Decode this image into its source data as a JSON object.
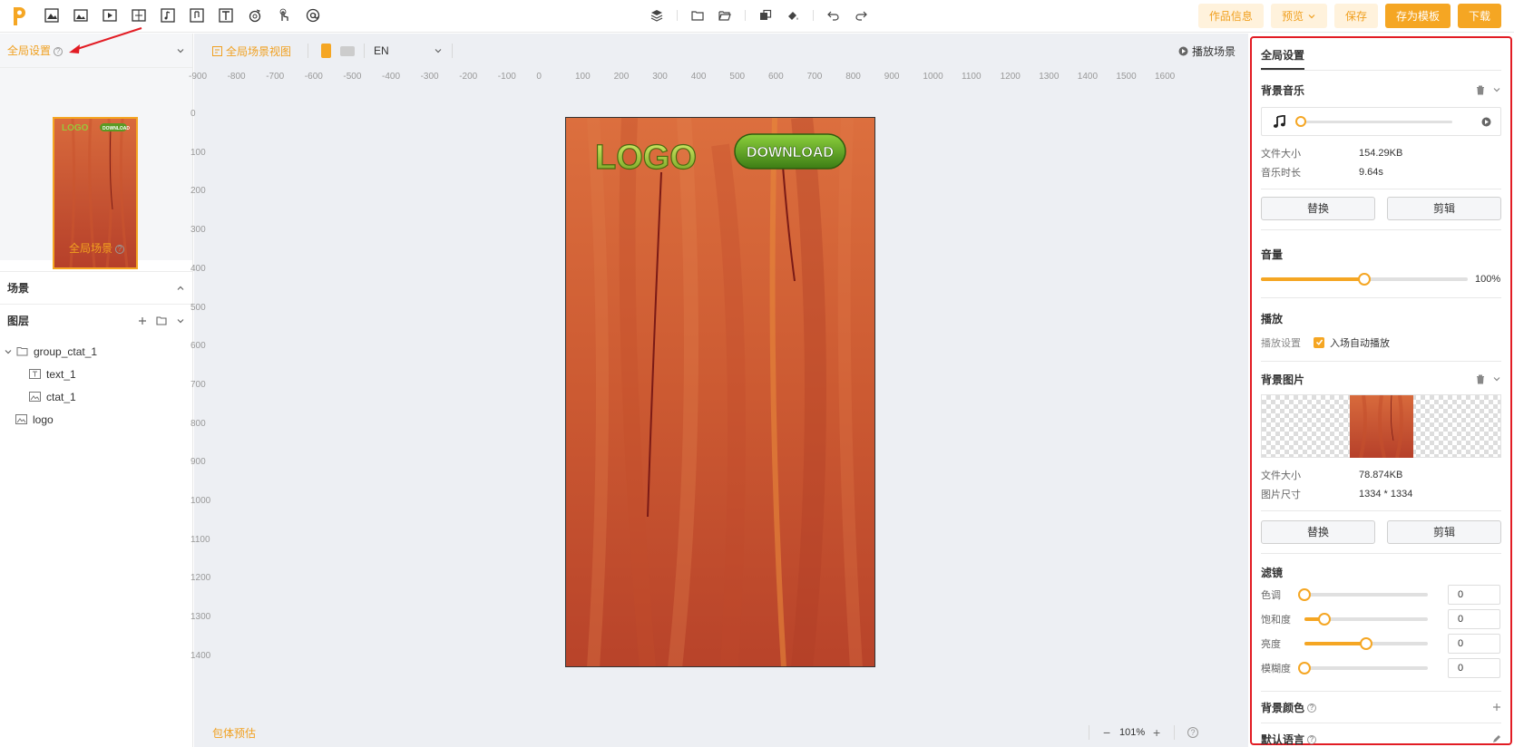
{
  "toolbar": {
    "buttons": {
      "info": "作品信息",
      "preview": "预览",
      "save": "保存",
      "save_template": "存为模板",
      "download": "下载"
    }
  },
  "left": {
    "global_settings": "全局设置",
    "global_scene": "全局场景",
    "scene_section": "场景",
    "layers_section": "图层",
    "layers": [
      "group_ctat_1",
      "text_1",
      "ctat_1",
      "logo"
    ]
  },
  "canvas": {
    "view_label": "全局场景视图",
    "language": "EN",
    "play_scene": "播放场景",
    "size_estimate": "包体预估",
    "zoom": "101%",
    "ruler_top": [
      "-900",
      "-800",
      "-700",
      "-600",
      "-500",
      "-400",
      "-300",
      "-200",
      "-100",
      "0",
      "100",
      "200",
      "300",
      "400",
      "500",
      "600",
      "700",
      "800",
      "900",
      "1000",
      "1100",
      "1200",
      "1300",
      "1400",
      "1500",
      "1600"
    ],
    "ruler_left": [
      "0",
      "100",
      "200",
      "300",
      "400",
      "500",
      "600",
      "700",
      "800",
      "900",
      "1000",
      "1100",
      "1200",
      "1300",
      "1400"
    ],
    "logo_text": "LOGO",
    "download_text": "DOWNLOAD"
  },
  "right": {
    "tab": "全局设置",
    "bg_music": "背景音乐",
    "file_size_label": "文件大小",
    "music_file_size": "154.29KB",
    "duration_label": "音乐时长",
    "music_duration": "9.64s",
    "replace": "替换",
    "edit": "剪辑",
    "volume_label": "音量",
    "volume_value": "100%",
    "volume_fraction": 0.5,
    "play_label": "播放",
    "play_setting_label": "播放设置",
    "autoplay_label": "入场自动播放",
    "bg_image": "背景图片",
    "image_file_size": "78.874KB",
    "image_size_label": "图片尺寸",
    "image_size": "1334 * 1334",
    "filter_label": "滤镜",
    "filters": [
      {
        "label": "色调",
        "value": "0",
        "fraction": 0.0
      },
      {
        "label": "饱和度",
        "value": "0",
        "fraction": 0.16
      },
      {
        "label": "亮度",
        "value": "0",
        "fraction": 0.5
      },
      {
        "label": "模糊度",
        "value": "0",
        "fraction": 0.0
      }
    ],
    "bg_color": "背景颜色",
    "default_lang": "默认语言"
  },
  "colors": {
    "accent": "#f5a623",
    "highlight_border": "#e21c24"
  }
}
